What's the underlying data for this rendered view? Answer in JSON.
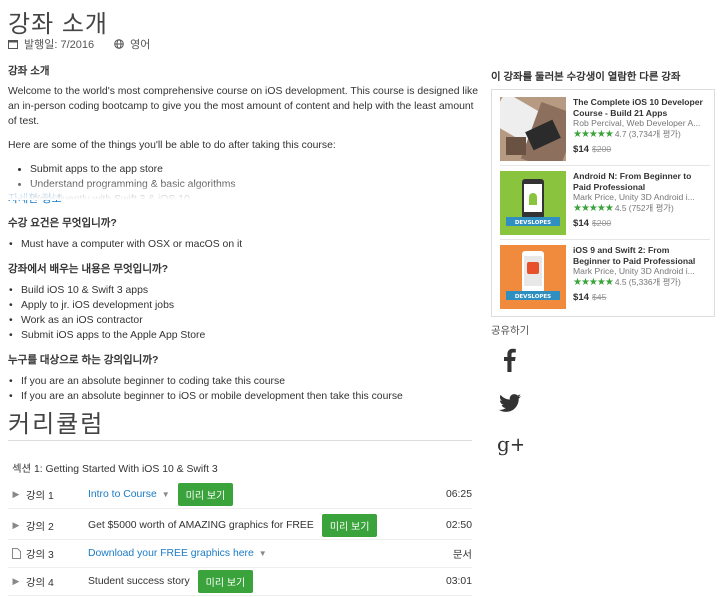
{
  "header": {
    "title": "강좌 소개",
    "published": "발행일: 7/2016",
    "language": "영어"
  },
  "description": {
    "heading": "강좌 소개",
    "intro": "Welcome to the world's most comprehensive course on iOS development. This course is designed like an in-person coding bootcamp to give you the most amount of content and help with the least amount of test.",
    "lead": "Here are some of the things you'll be able to do after taking this course:",
    "bullets": [
      "Submit apps to the app store",
      "Understand programming & basic algorithms",
      "Work fluently with Swift 3 & iOS 10"
    ],
    "more_link": "자세한 정보"
  },
  "requirements": {
    "heading": "수강 요건은 무엇입니까?",
    "items": [
      "Must have a computer with OSX or macOS on it"
    ]
  },
  "learn": {
    "heading": "강좌에서 배우는 내용은 무엇입니까?",
    "items": [
      "Build iOS 10 & Swift 3 apps",
      "Apply to jr. iOS development jobs",
      "Work as an iOS contractor",
      "Submit iOS apps to the Apple App Store"
    ]
  },
  "audience": {
    "heading": "누구를 대상으로 하는 강의입니까?",
    "items": [
      "If you are an absolute beginner to coding take this course",
      "If you are an absolute beginner to iOS or mobile development then take this course"
    ]
  },
  "curriculum": {
    "title": "커리큘럼",
    "section": "섹션 1: Getting Started With iOS 10 & Swift 3",
    "lectures": [
      {
        "num": "강의 1",
        "name": "Intro to Course",
        "preview": "미리 보기",
        "time": "06:25"
      },
      {
        "num": "강의 2",
        "name": "Get $5000 worth of AMAZING graphics for FREE",
        "preview": "미리 보기",
        "time": "02:50"
      },
      {
        "num": "강의 3",
        "name": "Download your FREE graphics here",
        "preview": "",
        "time": "문서"
      },
      {
        "num": "강의 4",
        "name": "Student success story",
        "preview": "미리 보기",
        "time": "03:01"
      }
    ]
  },
  "sidebar": {
    "heading": "이 강좌를 둘러본 수강생이 열람한 다른 강좌",
    "courses": [
      {
        "title1": "The Complete iOS 10 Developer",
        "title2": "Course - Build 21 Apps",
        "author": "Rob Percival, Web Developer A...",
        "stars": "★★★★★",
        "rating": "4.7 (3,734개 평가)",
        "price": "$14",
        "old": "$200"
      },
      {
        "title1": "Android N: From Beginner to",
        "title2": "Paid Professional",
        "author": "Mark Price, Unity 3D Android i...",
        "stars": "★★★★★",
        "rating": "4.5 (752개 평가)",
        "price": "$14",
        "old": "$200"
      },
      {
        "title1": "iOS 9 and Swift 2: From",
        "title2": "Beginner to Paid Professional",
        "author": "Mark Price, Unity 3D Android i...",
        "stars": "★★★★★",
        "rating": "4.5 (5,336개 평가)",
        "price": "$14",
        "old": "$45"
      }
    ],
    "thumb_label": "DEVSLOPES",
    "share": "공유하기",
    "social": [
      "facebook-icon",
      "twitter-icon",
      "google-plus-icon"
    ]
  },
  "colors": {
    "link": "#1b7bc4",
    "preview_button": "#3ba33b",
    "stars": "#3ba33b"
  }
}
